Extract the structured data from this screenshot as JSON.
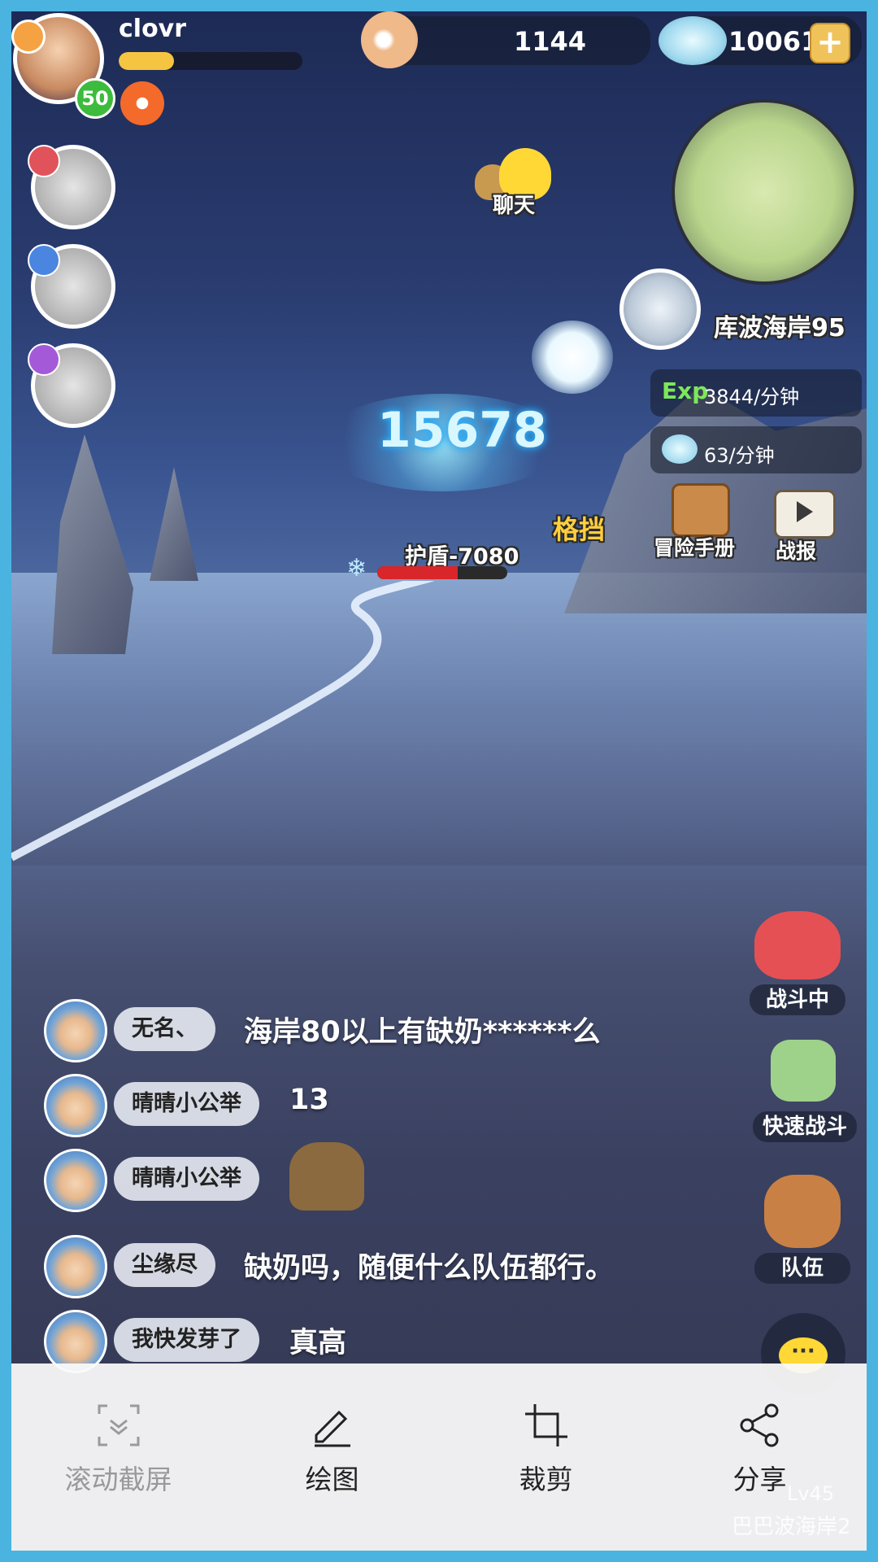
{
  "player": {
    "name": "clovr",
    "level": "50",
    "exp_fraction": 0.3
  },
  "currency": {
    "pearls": "1144",
    "shells": "10061"
  },
  "hud": {
    "chat_label": "聊天",
    "location": "库波海岸95",
    "exp_rate_prefix": "Exp",
    "exp_rate": "3844/分钟",
    "shell_rate": "63/分钟",
    "adventure_manual": "冒险手册",
    "battle_report": "战报"
  },
  "battle": {
    "damage_number": "15678",
    "shield_text": "护盾-7080",
    "block_text": "格挡",
    "hp_fraction": 0.62
  },
  "side_buttons": {
    "fighting": "战斗中",
    "quick_battle": "快速战斗",
    "team": "队伍"
  },
  "chat": [
    {
      "name": "无名、",
      "message": "海岸80以上有缺奶******么"
    },
    {
      "name": "晴晴小公举",
      "message": "13"
    },
    {
      "name": "晴晴小公举",
      "message": ""
    },
    {
      "name": "尘缘尽",
      "message": "缺奶吗，随便什么队伍都行。"
    },
    {
      "name": "我快发芽了",
      "message": "真高"
    }
  ],
  "background_watermark": {
    "level": "Lv45",
    "location": "巴巴波海岸2"
  },
  "toolbar": {
    "scroll_screenshot": "滚动截屏",
    "draw": "绘图",
    "crop": "裁剪",
    "share": "分享"
  },
  "colors": {
    "frame": "#4ab3e0",
    "exp_bar": "#f5c542",
    "level_badge": "#3dbb3d"
  }
}
